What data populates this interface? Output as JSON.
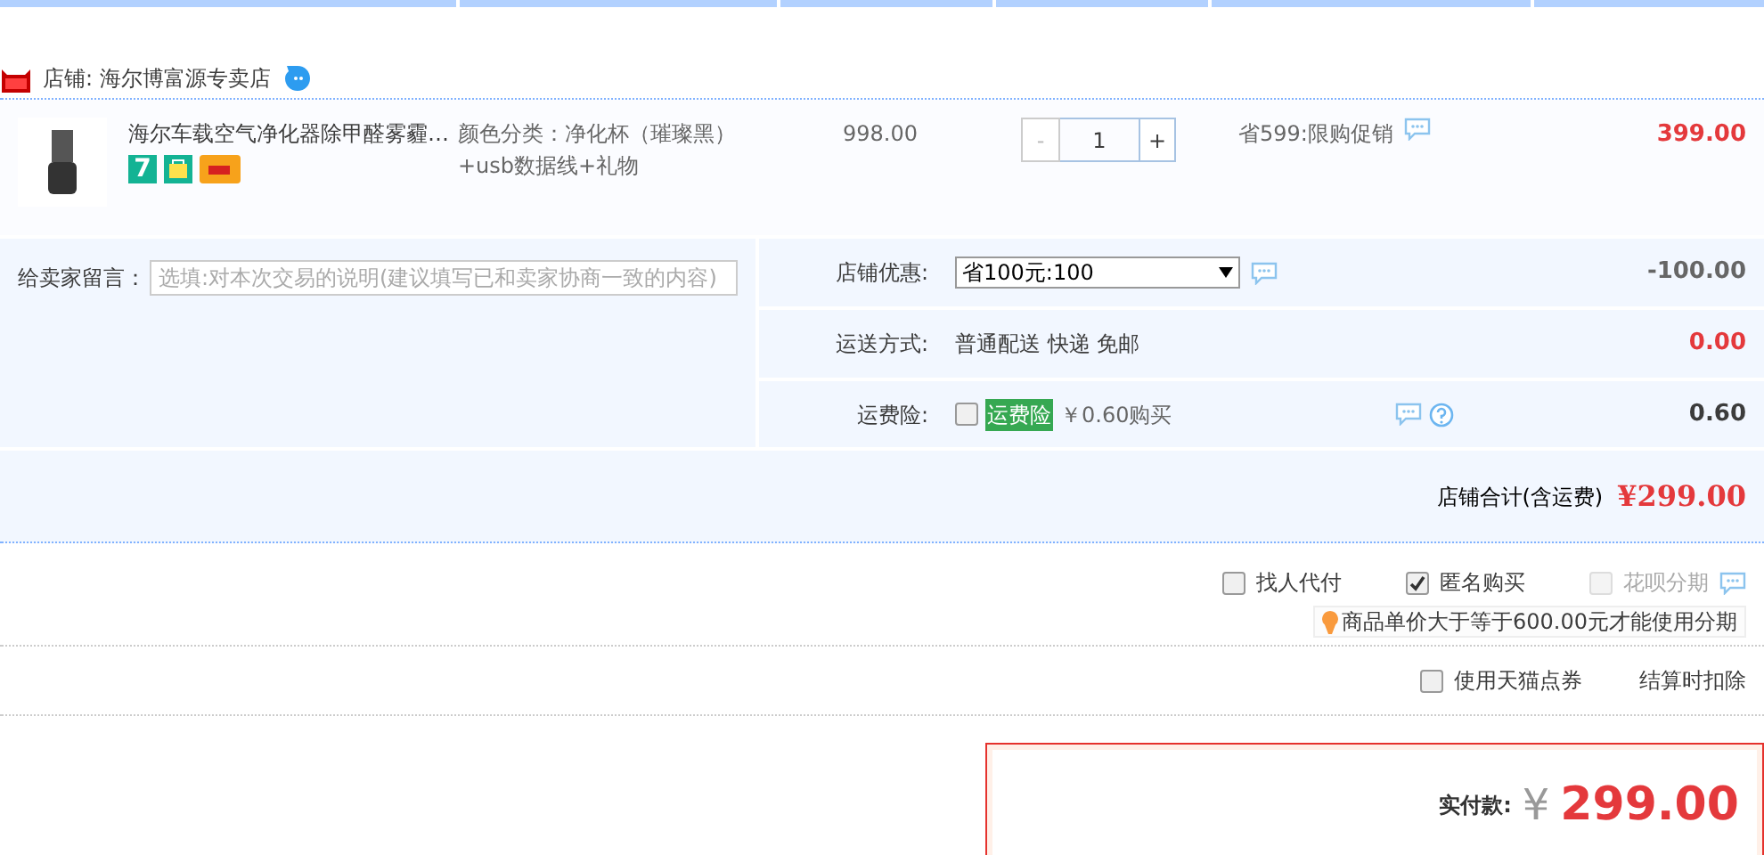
{
  "shop": {
    "name": "店铺: 海尔博富源专卖店"
  },
  "item": {
    "title": "海尔车载空气净化器除甲醛雾霾…",
    "badge": "7",
    "sku": "颜色分类：净化杯（璀璨黑）+usb数据线+礼物",
    "unit_price": "998.00",
    "decrement": "-",
    "quantity": "1",
    "increment": "+",
    "promotion": "省599:限购促销",
    "subtotal": "399.00"
  },
  "message": {
    "label": "给卖家留言：",
    "placeholder": "选填:对本次交易的说明(建议填写已和卖家协商一致的内容)"
  },
  "shop_discount": {
    "label": "店铺优惠:",
    "value": "省100元:100",
    "amount": "-100.00"
  },
  "shipping": {
    "label": "运送方式:",
    "value": "普通配送 快递 免邮",
    "amount": "0.00"
  },
  "insurance": {
    "label": "运费险:",
    "checked": false,
    "tag": "运费险",
    "price": "￥0.60购买",
    "amount": "0.60"
  },
  "shop_total": {
    "label": "店铺合计(含运费)",
    "amount": "¥299.00"
  },
  "options": [
    {
      "label": "找人代付",
      "checked": false,
      "disabled": false
    },
    {
      "label": "匿名购买",
      "checked": true,
      "disabled": false
    },
    {
      "label": "花呗分期",
      "checked": false,
      "disabled": true
    }
  ],
  "installment_tip": "商品单价大于等于600.00元才能使用分期",
  "coupon": {
    "label": "使用天猫点券",
    "checked": false,
    "note": "结算时扣除"
  },
  "payment": {
    "label": "实付款:",
    "currency": "¥",
    "amount": "299.00"
  }
}
